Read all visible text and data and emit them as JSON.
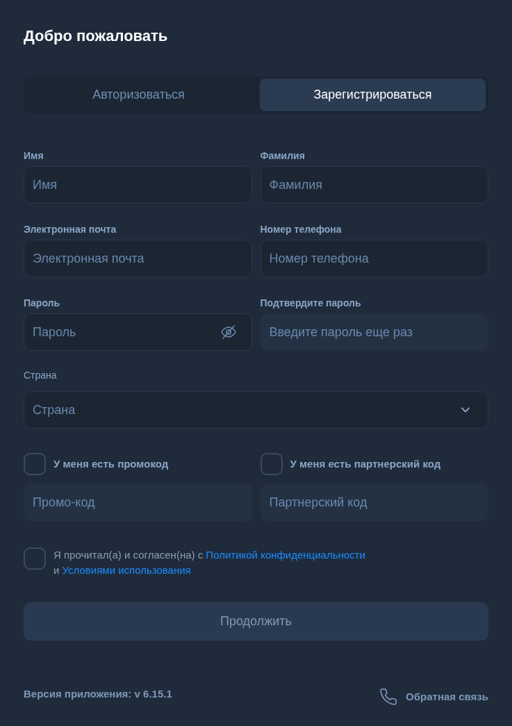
{
  "title": "Добро пожаловать",
  "tabs": [
    {
      "label": "Авторизоваться",
      "selected": false
    },
    {
      "label": "Зарегистрироваться",
      "selected": true
    }
  ],
  "fields": [
    {
      "kind": "text",
      "label": "Имя",
      "placeholder": "Имя",
      "disabled": false
    },
    {
      "kind": "text",
      "label": "Фамилия",
      "placeholder": "Фамилия",
      "disabled": false
    },
    {
      "kind": "text",
      "label": "Электронная почта",
      "placeholder": "Электронная почта",
      "disabled": false
    },
    {
      "kind": "text",
      "label": "Номер телефона",
      "placeholder": "Номер телефона",
      "disabled": false
    },
    {
      "kind": "password",
      "label": "Пароль",
      "placeholder": "Пароль",
      "disabled": false
    },
    {
      "kind": "text",
      "label": "Подтвердите пароль",
      "placeholder": "Введите пароль еще раз",
      "disabled": true
    }
  ],
  "country": {
    "label": "Страна",
    "placeholder": "Страна"
  },
  "codes": [
    {
      "label": "У меня есть промокод",
      "checked": false,
      "placeholder": "Промо-код",
      "disabled": true
    },
    {
      "label": "У меня есть партнерский код",
      "checked": false,
      "placeholder": "Партнерский код",
      "disabled": true
    }
  ],
  "agreement": {
    "checked": false,
    "parts": [
      {
        "kind": "text",
        "text": "Я прочитал(а) и согласен(на) с"
      },
      {
        "kind": "link",
        "text": "Политикой"
      },
      {
        "kind": "link",
        "text": "конфиденциальности"
      },
      {
        "kind": "text",
        "text": "и"
      },
      {
        "kind": "link",
        "text": "Условиями использования"
      }
    ]
  },
  "continue_button": {
    "label": "Продолжить",
    "disabled": true
  },
  "footer": {
    "version": "Версия приложения: v 6.15.1",
    "feedback": "Обратная связь"
  }
}
